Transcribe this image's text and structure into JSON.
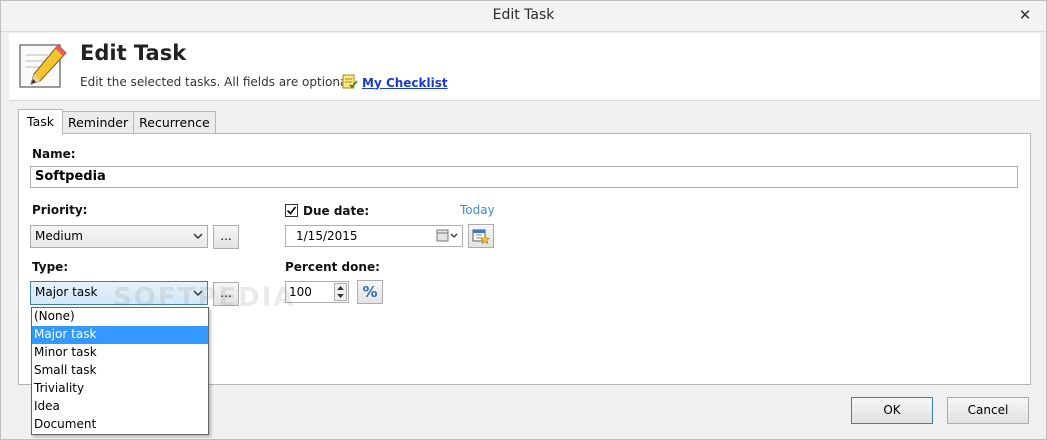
{
  "window": {
    "title": "Edit Task",
    "close_glyph": "✕"
  },
  "header": {
    "title": "Edit Task",
    "subtitle": "Edit the selected tasks. All fields are optional.",
    "checklist_link": "My Checklist",
    "icon": "pencil-edit-icon"
  },
  "tabs": [
    {
      "label": "Task",
      "active": true
    },
    {
      "label": "Reminder",
      "active": false
    },
    {
      "label": "Recurrence",
      "active": false
    }
  ],
  "form": {
    "name_label": "Name:",
    "name_value": "Softpedia",
    "priority_label": "Priority:",
    "priority_value": "Medium",
    "type_label": "Type:",
    "type_value": "Major task",
    "ellipsis": "...",
    "due_checked": true,
    "due_label": "Due date:",
    "today_link": "Today",
    "due_value": "1/15/2015",
    "percent_label": "Percent done:",
    "percent_value": "100",
    "percent_button": "%"
  },
  "type_options": [
    {
      "label": "(None)",
      "selected": false
    },
    {
      "label": "Major task",
      "selected": true
    },
    {
      "label": "Minor task",
      "selected": false
    },
    {
      "label": "Small task",
      "selected": false
    },
    {
      "label": "Triviality",
      "selected": false
    },
    {
      "label": "Idea",
      "selected": false
    },
    {
      "label": "Document",
      "selected": false
    }
  ],
  "footer": {
    "ok": "OK",
    "cancel": "Cancel"
  },
  "watermark": "SOFTPEDIA",
  "colors": {
    "link": "#1a3ad6",
    "today": "#3b8fd8",
    "selection": "#3399ff"
  }
}
